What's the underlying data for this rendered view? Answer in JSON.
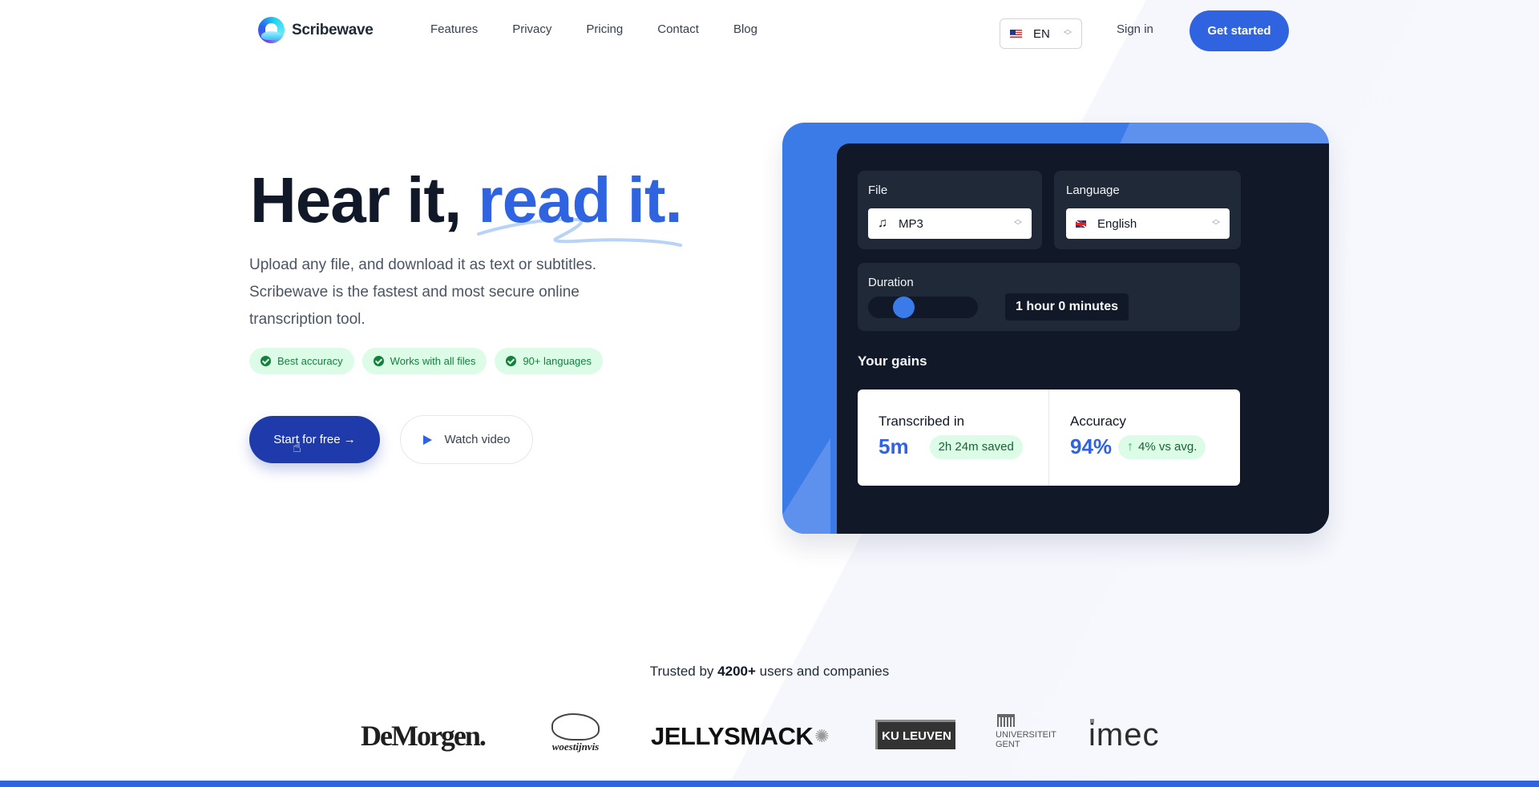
{
  "nav": {
    "brand": "Scribewave",
    "links": [
      "Features",
      "Privacy",
      "Pricing",
      "Contact",
      "Blog"
    ],
    "language": {
      "icon": "us-flag-icon",
      "value": "EN"
    },
    "sign_in": "Sign in",
    "get_started": "Get started"
  },
  "hero": {
    "title_part1": "Hear it, ",
    "title_part2": "read it.",
    "subtitle": "Upload any file, and download it as text or subtitles. Scribewave is the fastest and most secure online transcription tool.",
    "badges": [
      "Best accuracy",
      "Works with all files",
      "90+ languages"
    ],
    "cta_primary": "Start for free →",
    "cta_secondary": "Watch video"
  },
  "calculator": {
    "file": {
      "label": "File",
      "icon": "music-note-icon",
      "value": "MP3"
    },
    "language": {
      "label": "Language",
      "icon": "uk-flag-icon",
      "value": "English"
    },
    "duration": {
      "label": "Duration",
      "slider_fraction": 0.17,
      "value": "1 hour 0 minutes"
    },
    "gains_title": "Your gains",
    "transcribed": {
      "label": "Transcribed in",
      "value": "5m",
      "pill": "2h 24m saved"
    },
    "accuracy": {
      "label": "Accuracy",
      "value": "94%",
      "pill": "4% vs avg.",
      "pill_icon": "arrow-up-icon"
    }
  },
  "trusted": {
    "prefix": "Trusted by ",
    "count": "4200+",
    "suffix": " users and companies",
    "logos": [
      "DeMorgen.",
      "woestijnvis",
      "JELLYSMACK",
      "KU LEUVEN",
      "UNIVERSITEIT GENT",
      "imec"
    ]
  },
  "colors": {
    "accent": "#2f63e0",
    "cta_primary": "#1e3aab",
    "card_dark": "#111827",
    "success_bg": "#dcfce7",
    "success_text": "#15803d"
  }
}
